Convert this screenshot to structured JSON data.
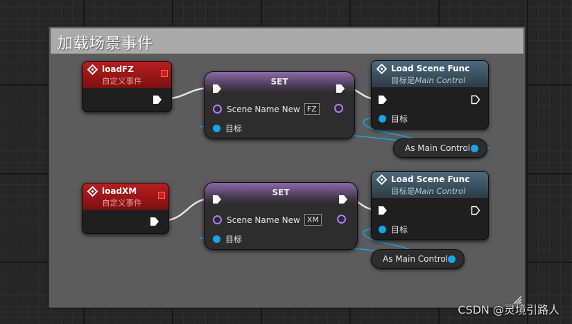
{
  "comment": {
    "title": "加载场景事件"
  },
  "groups": [
    {
      "event": {
        "title": "loadFZ",
        "subtitle": "自定义事件"
      },
      "set": {
        "title": "SET",
        "pin_label": "Scene Name New",
        "value": "FZ",
        "target_label": "目标"
      },
      "func": {
        "title": "Load Scene Func",
        "subtitle_prefix": "目标是",
        "subtitle_target": "Main Control",
        "target_label": "目标"
      },
      "cast": {
        "label": "As Main Control"
      }
    },
    {
      "event": {
        "title": "loadXM",
        "subtitle": "自定义事件"
      },
      "set": {
        "title": "SET",
        "pin_label": "Scene Name New",
        "value": "XM",
        "target_label": "目标"
      },
      "func": {
        "title": "Load Scene Func",
        "subtitle_prefix": "目标是",
        "subtitle_target": "Main Control",
        "target_label": "目标"
      },
      "cast": {
        "label": "As Main Control"
      }
    }
  ],
  "colors": {
    "exec_wire": "#e8e8e8",
    "object_pin": "#16a6e5",
    "string_pin": "#b57bf5",
    "event_header": "#b81e1e",
    "func_header": "#4c6a7c"
  },
  "watermark": "CSDN @灵境引路人"
}
